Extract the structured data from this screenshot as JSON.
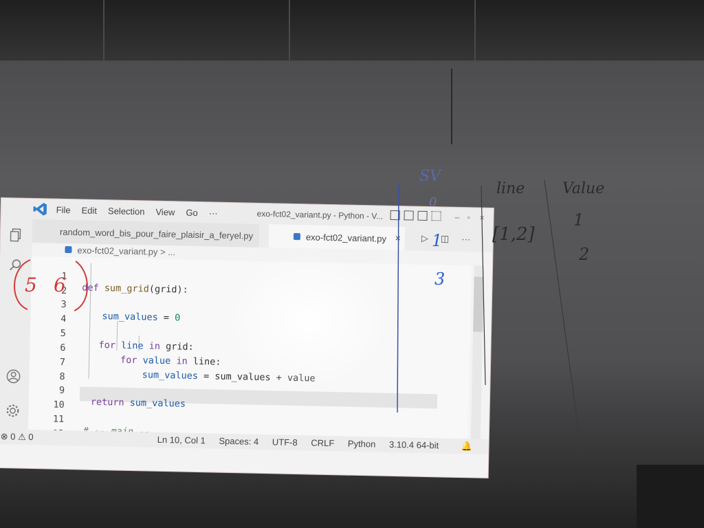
{
  "titlebar": {
    "menu": [
      "File",
      "Edit",
      "Selection",
      "View",
      "Go",
      "···"
    ],
    "window_title": "exo-fct02_variant.py - Python - V..."
  },
  "tabs": {
    "inactive_label": "random_word_bis_pour_faire_plaisir_a_feryel.py",
    "active_label": "exo-fct02_variant.py",
    "close_glyph": "×",
    "actions": [
      "▷",
      "◫",
      "···"
    ]
  },
  "breadcrumb": "exo-fct02_variant.py > ...",
  "code": {
    "line_numbers": [
      "1",
      "2",
      "3",
      "4",
      "5",
      "6",
      "7",
      "8",
      "9",
      "10",
      "11",
      "12"
    ],
    "l1_kw": "def",
    "l1_fn": "sum_grid",
    "l1_rest": "(grid):",
    "l3_var": "sum_values",
    "l3_op": " = ",
    "l3_num": "0",
    "l5_kw1": "for",
    "l5_var": "line",
    "l5_kw2": "in",
    "l5_rest": "grid:",
    "l6_kw1": "for",
    "l6_var": "value",
    "l6_kw2": "in",
    "l6_rest": "line:",
    "l7_var1": "sum_values",
    "l7_rest": " = sum_values + value",
    "l9_kw": "return",
    "l9_var": "sum_values",
    "l11_comment": "# -- main --"
  },
  "status": {
    "problems": "⊗ 0 ⚠ 0",
    "position": "Ln 10, Col 1",
    "spaces": "Spaces: 4",
    "encoding": "UTF-8",
    "eol": "CRLF",
    "language": "Python",
    "interpreter": "3.10.4 64-bit"
  },
  "handwriting": {
    "red_digits": [
      "5",
      "6"
    ],
    "blue_marks": [
      "SV",
      "0",
      "1",
      "3"
    ],
    "board_headers": [
      "line",
      "Value"
    ],
    "board_list": "[1,2]",
    "board_values": [
      "1",
      "2"
    ]
  },
  "colors": {
    "keyword": "#7a3e9d",
    "variable": "#1e5aa8",
    "number": "#098658",
    "comment": "#6a8a6a",
    "red_marker": "#d23a3a",
    "blue_marker": "#2a5fd0"
  }
}
